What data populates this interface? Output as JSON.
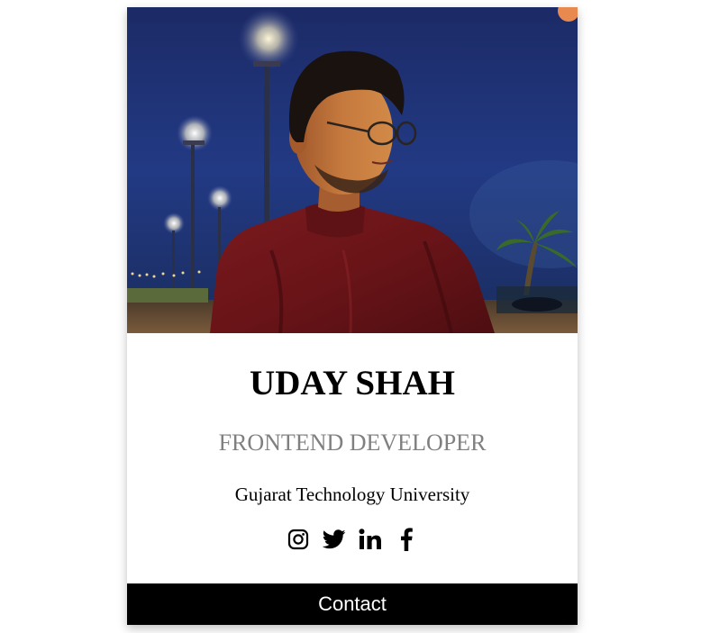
{
  "profile": {
    "name": "UDAY SHAH",
    "title": "FRONTEND DEVELOPER",
    "school": "Gujarat Technology University",
    "photo_icon": "profile-photo",
    "contact_label": "Contact"
  },
  "socials": [
    {
      "icon": "instagram-icon"
    },
    {
      "icon": "twitter-icon"
    },
    {
      "icon": "linkedin-icon"
    },
    {
      "icon": "facebook-icon"
    }
  ],
  "colors": {
    "title": "#808080",
    "contact_bg": "#000000",
    "contact_text": "#ffffff"
  }
}
